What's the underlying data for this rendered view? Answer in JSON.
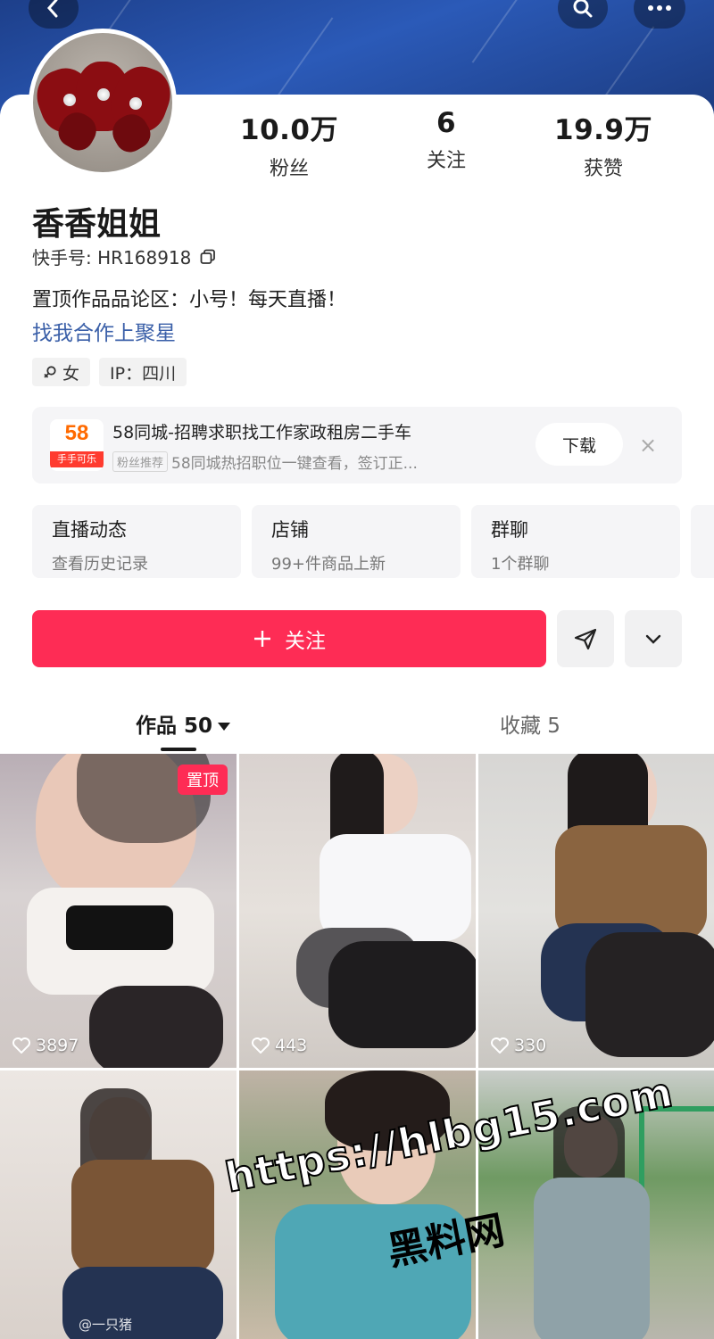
{
  "profile": {
    "name": "香香姐姐",
    "uid": "快手号: HR168918",
    "bio": "置顶作品品论区：小号！每天直播！",
    "link": "找我合作上聚星",
    "tags": [
      "女",
      "IP：四川"
    ]
  },
  "stats": [
    {
      "value": "10.0万",
      "label": "粉丝"
    },
    {
      "value": "6",
      "label": "关注"
    },
    {
      "value": "19.9万",
      "label": "获赞"
    }
  ],
  "ad": {
    "logo_text": "58",
    "logo_strip": "手手可乐",
    "title": "58同城-招聘求职找工作家政租房二手车",
    "badge": "粉丝推荐",
    "subtitle": "58同城热招职位一键查看，签订正...",
    "download_label": "下载",
    "close_label": "×"
  },
  "entries": [
    {
      "title": "直播动态",
      "subtitle": "查看历史记录"
    },
    {
      "title": "店铺",
      "subtitle": "99+件商品上新"
    },
    {
      "title": "群聊",
      "subtitle": "1个群聊"
    }
  ],
  "actions": {
    "follow_label": "关注"
  },
  "tabs": {
    "works_label": "作品 50",
    "favorites_label": "收藏 5"
  },
  "grid": [
    {
      "likes": "3897",
      "pinned": "置顶"
    },
    {
      "likes": "443"
    },
    {
      "likes": "330"
    },
    {
      "likes": "",
      "credit": "@一只猪"
    },
    {
      "likes": ""
    },
    {
      "likes": ""
    }
  ],
  "watermark": {
    "url": "https://hlbg15.com",
    "site": "黑料网"
  },
  "icons": {
    "back": "chevron-left-icon",
    "search": "search-icon",
    "more": "more-icon",
    "copy": "copy-icon",
    "gender": "female-icon",
    "send": "send-icon",
    "expand": "chevron-down-icon",
    "heart": "heart-icon",
    "plus": "plus-icon"
  },
  "colors": {
    "accent": "#fe2c55",
    "link": "#3a5fa8",
    "banner": "#2b5ab8"
  }
}
